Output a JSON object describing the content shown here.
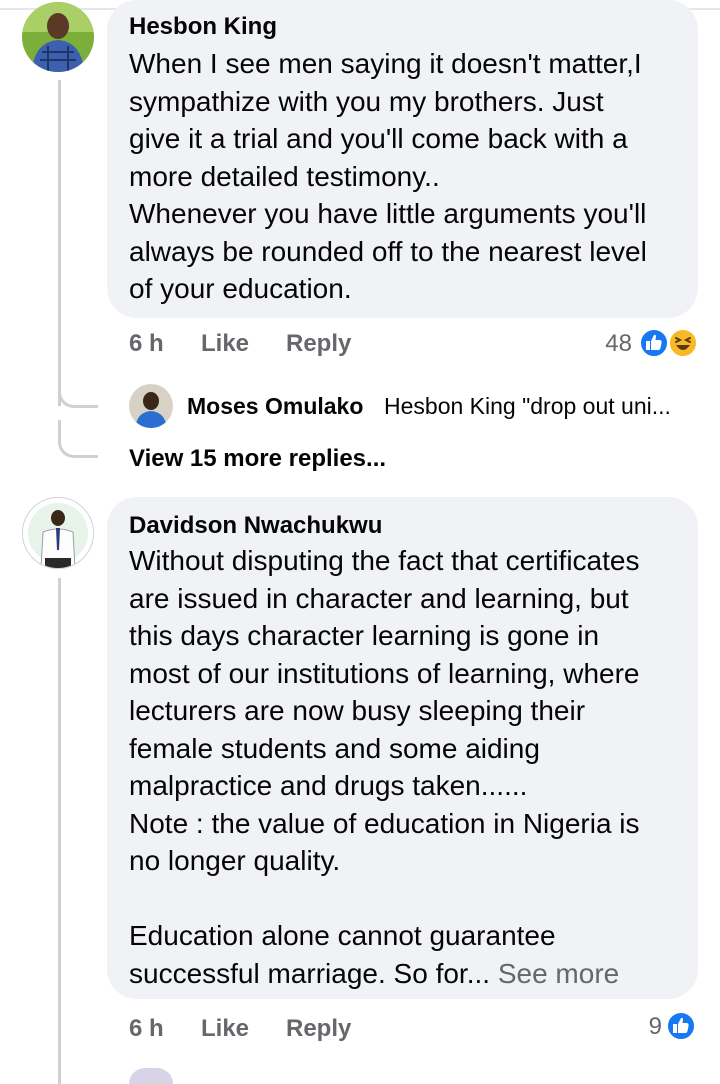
{
  "comments": [
    {
      "author": "Hesbon King",
      "text": "When I see men saying it doesn't matter,I\nsympathize with you my brothers. Just\ngive it a trial and you'll come back with a\nmore detailed testimony..\nWhenever you have little arguments you'll\nalways be rounded off to the nearest level\nof your education.",
      "time": "6 h",
      "like_label": "Like",
      "reply_label": "Reply",
      "reaction_count": "48",
      "reactions": [
        "like-icon",
        "haha-icon"
      ],
      "reply": {
        "author": "Moses Omulako",
        "snippet": "Hesbon King \"drop out uni..."
      },
      "view_more_label": "View 15 more replies..."
    },
    {
      "author": "Davidson Nwachukwu",
      "text": "Without disputing the fact that certificates\nare issued in character and learning, but\nthis days character learning is gone in\nmost of our institutions of learning, where\nlecturers are now busy sleeping their\nfemale students and some aiding\nmalpractice and drugs taken......\nNote : the value of education in Nigeria is\nno longer quality.\n\nEducation alone cannot guarantee\nsuccessful marriage. So for...",
      "see_more_label": "See more",
      "time": "6 h",
      "like_label": "Like",
      "reply_label": "Reply",
      "reaction_count": "9",
      "reactions": [
        "like-icon"
      ]
    }
  ],
  "colors": {
    "bubble": "#f0f2f5",
    "meta": "#65676b",
    "like_blue": "#1877f2",
    "haha_yellow": "#f7b928"
  }
}
